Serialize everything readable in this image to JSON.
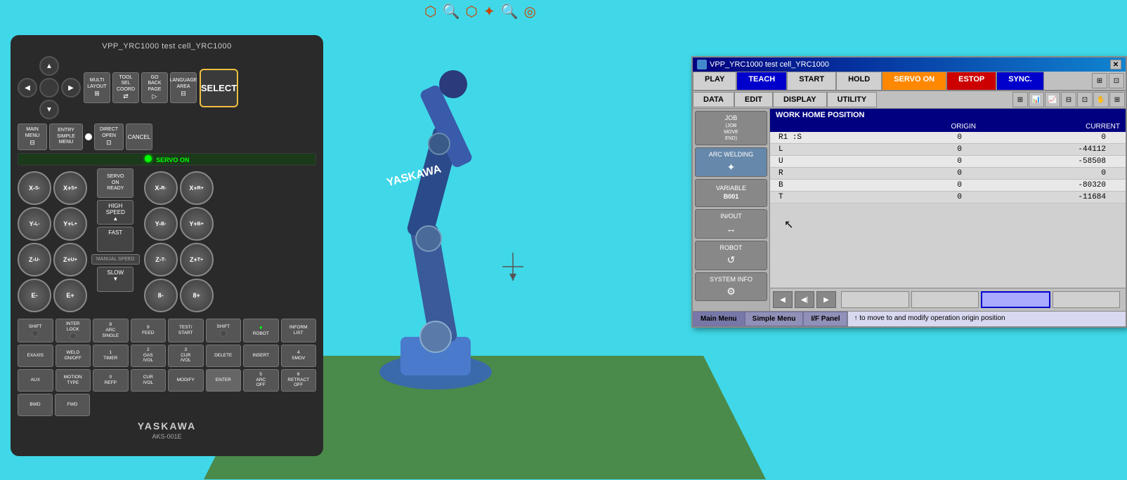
{
  "pendant": {
    "title": "VPP_YRC1000 test cell_YRC1000",
    "brand": "YASKAWA",
    "model": "AKS-001E",
    "servo_on": "SERVO ON",
    "select_label": "SELECT",
    "cancel_label": "CANCEL",
    "buttons_top": [
      {
        "label": "MULTI\nLAYOUT",
        "sub": ""
      },
      {
        "label": "TOOL SEL\nCOORD",
        "sub": ""
      },
      {
        "label": "GO BACK\nPAGE",
        "sub": ""
      },
      {
        "label": "LANGUAGE\nAREA",
        "sub": ""
      }
    ],
    "buttons_mid_left": [
      {
        "label": "MAIN\nMENU",
        "sub": ""
      },
      {
        "label": "ENTRY\nSIMPLE\nMENU",
        "sub": ""
      },
      {
        "label": "DIRECT\nOPEN",
        "sub": ""
      }
    ],
    "axis_buttons": [
      "X-\nS-",
      "X+\nS+",
      "Y-\nL-",
      "Y+\nL+",
      "Z-\nU-",
      "Z+\nU+",
      "E-",
      "E+",
      "X-\nR-",
      "X+\nR+",
      "Y-\nB-",
      "Y+\nB+",
      "Z-\nT-",
      "Z+\nT+",
      "8-",
      "8+"
    ],
    "speed_buttons": [
      "HIGH\nSPEED",
      "FAST",
      "SLOW"
    ],
    "bottom_buttons": [
      {
        "label": "SHIFT",
        "type": "normal"
      },
      {
        "label": "INTER\nLOCK",
        "type": "normal"
      },
      {
        "label": "8\nARC\nSINGLE",
        "type": "normal"
      },
      {
        "label": "9\nFEED",
        "type": "normal"
      },
      {
        "label": "TEST/\nSTART",
        "type": "normal"
      },
      {
        "label": "SHIFT",
        "type": "normal"
      },
      {
        "label": "ROBOT",
        "type": "green-led"
      },
      {
        "label": "INFORM\nLIST",
        "type": "normal"
      },
      {
        "label": "4\nSMOV",
        "type": "normal"
      },
      {
        "label": "5\nARC\nOFF",
        "type": "normal"
      },
      {
        "label": "6\nRETRACT\nOFF",
        "type": "normal"
      },
      {
        "label": "BWD",
        "type": "normal"
      },
      {
        "label": "FWD",
        "type": "normal"
      },
      {
        "label": "EXAXIS",
        "type": "normal"
      },
      {
        "label": "WELD\nON/OFF",
        "type": "normal"
      },
      {
        "label": "1\nTIMER",
        "type": "normal"
      },
      {
        "label": "2\nGAS\nVOL",
        "type": "normal"
      },
      {
        "label": "3\nCUR\nVOL",
        "type": "normal"
      },
      {
        "label": "DELETE",
        "type": "normal"
      },
      {
        "label": "INSERT",
        "type": "normal"
      },
      {
        "label": "AUX",
        "type": "normal"
      },
      {
        "label": "MOTION\nTYPE",
        "type": "normal"
      },
      {
        "label": "0\nREFP",
        "type": "normal"
      },
      {
        "label": "CUR\nVOL",
        "type": "normal"
      },
      {
        "label": "MODIFY",
        "type": "normal"
      },
      {
        "label": "ENTER",
        "type": "normal"
      }
    ]
  },
  "toolbar": {
    "icons": [
      "⟳",
      "🔍",
      "⟳",
      "✦",
      "🔍",
      "◎"
    ]
  },
  "yrc_window": {
    "title": "VPP_YRC1000 test cell_YRC1000",
    "tabs_row1": [
      {
        "label": "PLAY",
        "state": "normal"
      },
      {
        "label": "TEACH",
        "state": "active"
      },
      {
        "label": "START",
        "state": "normal"
      },
      {
        "label": "HOLD",
        "state": "normal"
      },
      {
        "label": "SERVO ON",
        "state": "orange"
      },
      {
        "label": "ESTOP",
        "state": "estop"
      },
      {
        "label": "SYNC.",
        "state": "blue-sync"
      }
    ],
    "tabs_row2": [
      {
        "label": "DATA",
        "state": "normal"
      },
      {
        "label": "EDIT",
        "state": "normal"
      },
      {
        "label": "DISPLAY",
        "state": "normal"
      },
      {
        "label": "UTILITY",
        "state": "normal"
      }
    ],
    "sidebar_items": [
      {
        "label": "JOB\n(JOB\nMOVE\nEND)",
        "icon": "📋"
      },
      {
        "label": "ARC WELDING",
        "icon": "✦"
      },
      {
        "label": "VARIABLE\nB001",
        "icon": ""
      },
      {
        "label": "IN/OUT",
        "icon": "↔"
      },
      {
        "label": "ROBOT",
        "icon": "↺"
      },
      {
        "label": "SYSTEM INFO",
        "icon": "⚙"
      }
    ],
    "work_home": {
      "title": "WORK HOME POSITION",
      "origin_label": "ORIGIN",
      "current_label": "CURRENT",
      "rows": [
        {
          "label": "R1 :S",
          "origin": "0",
          "current": "0"
        },
        {
          "label": "L",
          "origin": "0",
          "current": "-44112"
        },
        {
          "label": "U",
          "origin": "0",
          "current": "-58508"
        },
        {
          "label": "R",
          "origin": "0",
          "current": "0"
        },
        {
          "label": "B",
          "origin": "0",
          "current": "-80320"
        },
        {
          "label": "T",
          "origin": "0",
          "current": "-11684"
        }
      ]
    },
    "footer": {
      "main_menu": "Main Menu",
      "simple_menu": "Simple Menu",
      "if_panel": "I/F Panel",
      "status_text": "↑ to move to and modify operation origin position"
    }
  }
}
